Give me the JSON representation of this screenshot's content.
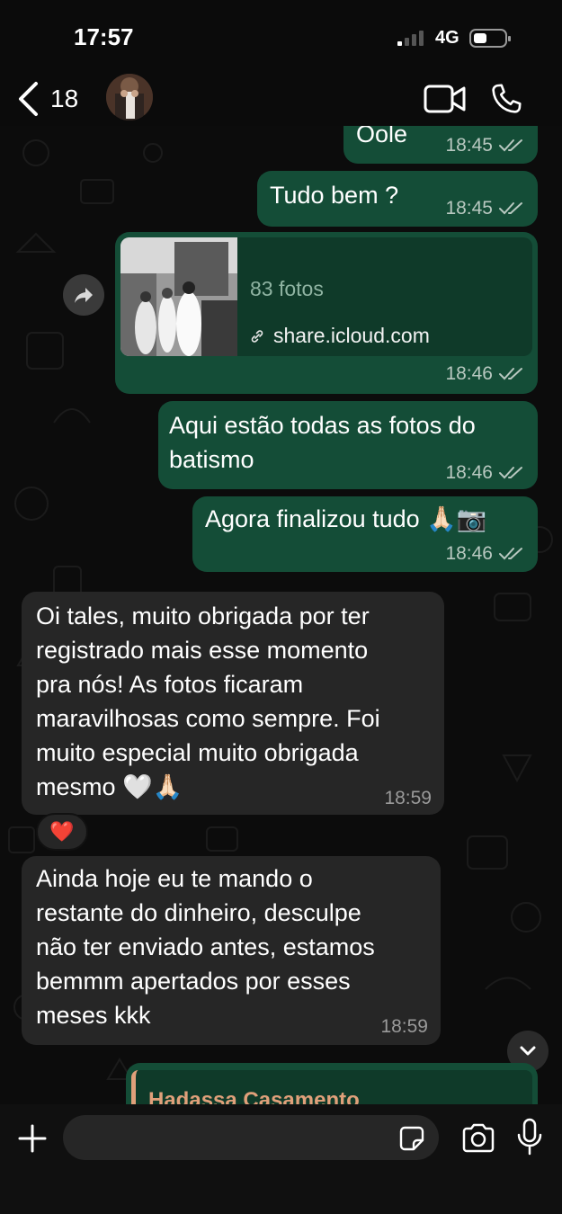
{
  "status_bar": {
    "time": "17:57",
    "network": "4G"
  },
  "header": {
    "back_count": "18"
  },
  "messages": {
    "m1": {
      "text": "Oole",
      "time": "18:45"
    },
    "m2": {
      "text": "Tudo bem ?",
      "time": "18:45"
    },
    "m3": {
      "photos_count": "83 fotos",
      "link": "share.icloud.com",
      "time": "18:46"
    },
    "m4": {
      "text": "Aqui estão todas as fotos do\nbatismo",
      "time": "18:46"
    },
    "m5": {
      "text": "Agora finalizou tudo 🙏🏻📷",
      "time": "18:46"
    },
    "m6": {
      "text": "Oi tales, muito obrigada por ter\nregistrado mais esse momento\npra nós! As fotos ficaram\nmaravilhosas como sempre. Foi\nmuito especial muito obrigada\nmesmo 🤍🙏🏻",
      "time": "18:59",
      "reaction": "❤️"
    },
    "m7": {
      "text": "Ainda hoje eu te mando o\nrestante do dinheiro, desculpe\nnão ter enviado antes, estamos\nbemmm apertados por esses\nmeses kkk",
      "time": "18:59"
    },
    "m8": {
      "quote_author": "Hadassa Casamento"
    }
  },
  "colors": {
    "outgoing_bubble": "#144d37",
    "incoming_bubble": "#262626",
    "quote_author": "#e0a07a",
    "background": "#0c0c0c"
  },
  "icons": [
    "chevron-left-icon",
    "video-call-icon",
    "phone-icon",
    "forward-icon",
    "link-icon",
    "double-check-icon",
    "chevron-down-icon",
    "plus-icon",
    "sticker-icon",
    "camera-icon",
    "microphone-icon"
  ]
}
